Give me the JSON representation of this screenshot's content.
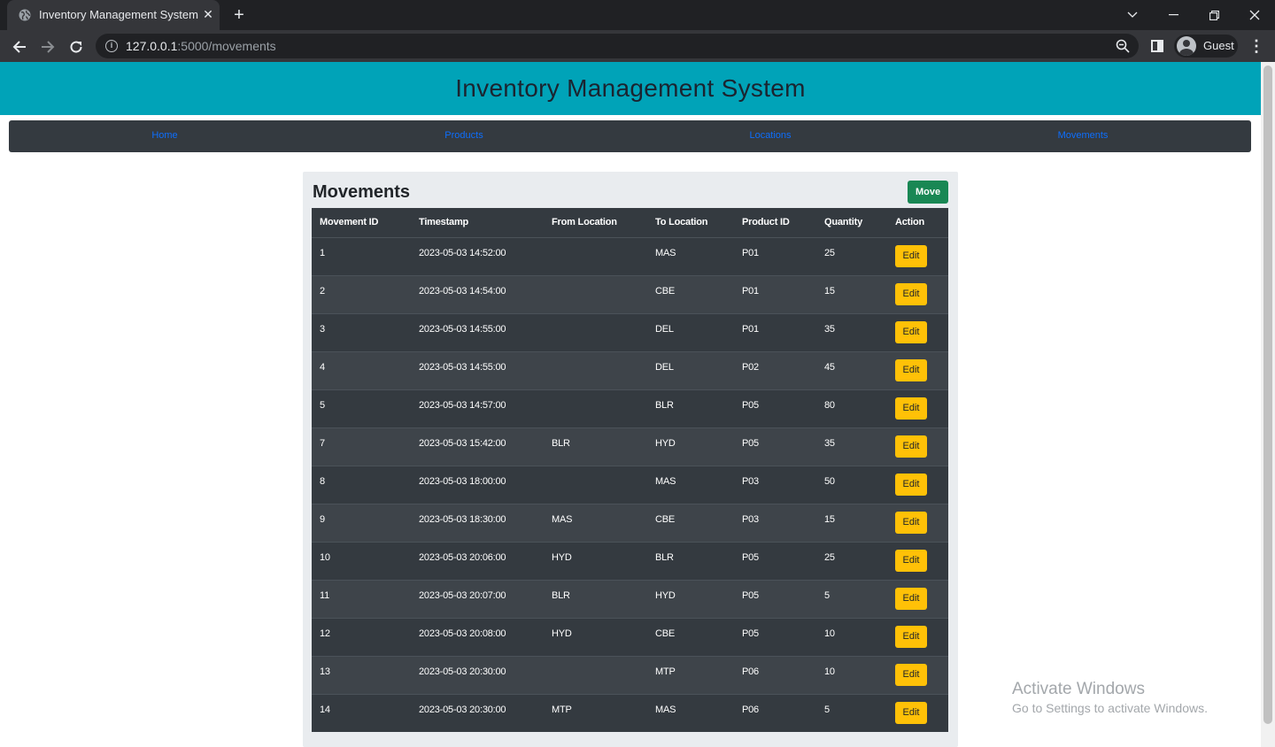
{
  "browser": {
    "tab_title": "Inventory Management System",
    "url_host": "127.0.0.1",
    "url_rest": ":5000/movements",
    "profile_name": "Guest"
  },
  "header": {
    "title": "Inventory Management System"
  },
  "nav": {
    "items": [
      {
        "label": "Home"
      },
      {
        "label": "Products"
      },
      {
        "label": "Locations"
      },
      {
        "label": "Movements"
      }
    ]
  },
  "movements": {
    "title": "Movements",
    "move_button": "Move",
    "columns": [
      "Movement ID",
      "Timestamp",
      "From Location",
      "To Location",
      "Product ID",
      "Quantity",
      "Action"
    ],
    "edit_label": "Edit",
    "rows": [
      {
        "id": "1",
        "timestamp": "2023-05-03 14:52:00",
        "from": "",
        "to": "MAS",
        "product": "P01",
        "qty": "25"
      },
      {
        "id": "2",
        "timestamp": "2023-05-03 14:54:00",
        "from": "",
        "to": "CBE",
        "product": "P01",
        "qty": "15"
      },
      {
        "id": "3",
        "timestamp": "2023-05-03 14:55:00",
        "from": "",
        "to": "DEL",
        "product": "P01",
        "qty": "35"
      },
      {
        "id": "4",
        "timestamp": "2023-05-03 14:55:00",
        "from": "",
        "to": "DEL",
        "product": "P02",
        "qty": "45"
      },
      {
        "id": "5",
        "timestamp": "2023-05-03 14:57:00",
        "from": "",
        "to": "BLR",
        "product": "P05",
        "qty": "80"
      },
      {
        "id": "7",
        "timestamp": "2023-05-03 15:42:00",
        "from": "BLR",
        "to": "HYD",
        "product": "P05",
        "qty": "35"
      },
      {
        "id": "8",
        "timestamp": "2023-05-03 18:00:00",
        "from": "",
        "to": "MAS",
        "product": "P03",
        "qty": "50"
      },
      {
        "id": "9",
        "timestamp": "2023-05-03 18:30:00",
        "from": "MAS",
        "to": "CBE",
        "product": "P03",
        "qty": "15"
      },
      {
        "id": "10",
        "timestamp": "2023-05-03 20:06:00",
        "from": "HYD",
        "to": "BLR",
        "product": "P05",
        "qty": "25"
      },
      {
        "id": "11",
        "timestamp": "2023-05-03 20:07:00",
        "from": "BLR",
        "to": "HYD",
        "product": "P05",
        "qty": "5"
      },
      {
        "id": "12",
        "timestamp": "2023-05-03 20:08:00",
        "from": "HYD",
        "to": "CBE",
        "product": "P05",
        "qty": "10"
      },
      {
        "id": "13",
        "timestamp": "2023-05-03 20:30:00",
        "from": "",
        "to": "MTP",
        "product": "P06",
        "qty": "10"
      },
      {
        "id": "14",
        "timestamp": "2023-05-03 20:30:00",
        "from": "MTP",
        "to": "MAS",
        "product": "P06",
        "qty": "5"
      }
    ]
  },
  "watermark": {
    "line1": "Activate Windows",
    "line2": "Go to Settings to activate Windows."
  },
  "colors": {
    "header_bg": "#00a3b8",
    "nav_bg": "#343a40",
    "nav_link": "#0d6efd",
    "move_button": "#198754",
    "edit_button": "#ffc107"
  }
}
